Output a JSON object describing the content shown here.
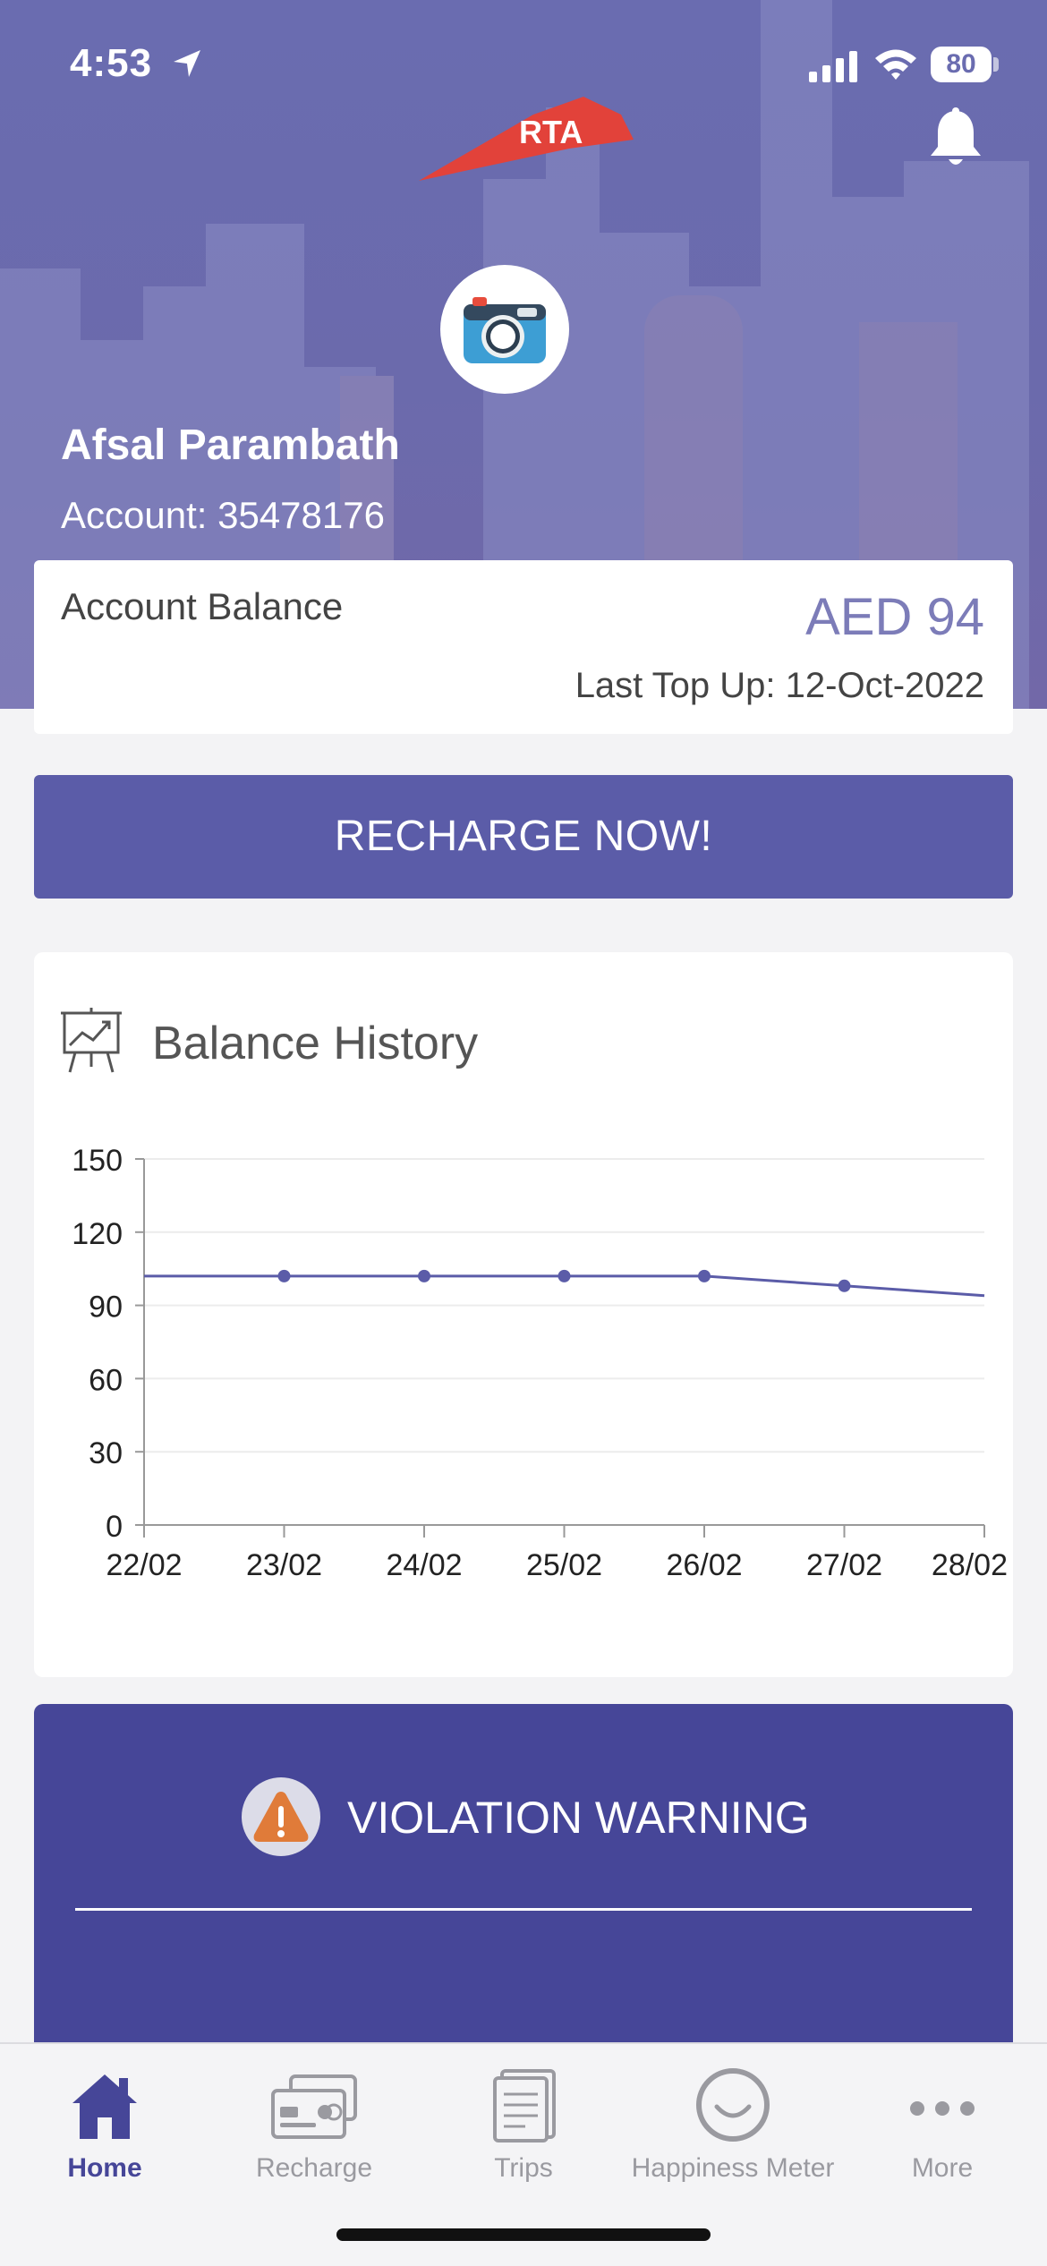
{
  "status_bar": {
    "time": "4:53",
    "battery": "80"
  },
  "header": {
    "logo_text": "RTA"
  },
  "profile": {
    "name": "Afsal Parambath",
    "account": "Account: 35478176"
  },
  "balance": {
    "label": "Account Balance",
    "value": "AED 94",
    "last_top_up": "Last Top Up: 12-Oct-2022"
  },
  "recharge_button": "RECHARGE NOW!",
  "balance_history": {
    "title": "Balance History"
  },
  "chart_data": {
    "type": "line",
    "title": "Balance History",
    "categories": [
      "22/02",
      "23/02",
      "24/02",
      "25/02",
      "26/02",
      "27/02",
      "28/02"
    ],
    "series": [
      {
        "values": [
          102,
          102,
          102,
          102,
          102,
          98,
          94
        ]
      }
    ],
    "ylim": [
      0,
      150
    ],
    "yticks": [
      0,
      30,
      60,
      90,
      120,
      150
    ],
    "grid": true,
    "color": "#5b5ca8"
  },
  "violation": {
    "title": "VIOLATION WARNING"
  },
  "tab_bar": {
    "tabs": [
      {
        "label": "Home",
        "icon": "home-icon",
        "active": true
      },
      {
        "label": "Recharge",
        "icon": "card-icon",
        "active": false
      },
      {
        "label": "Trips",
        "icon": "document-icon",
        "active": false
      },
      {
        "label": "Happiness Meter",
        "icon": "smile-icon",
        "active": false
      },
      {
        "label": "More",
        "icon": "more-dots-icon",
        "active": false
      }
    ]
  },
  "colors": {
    "brand_purple": "#5b5ca8",
    "dark_purple": "#464698",
    "rta_red": "#e2423a",
    "warning_orange": "#e07b39"
  }
}
